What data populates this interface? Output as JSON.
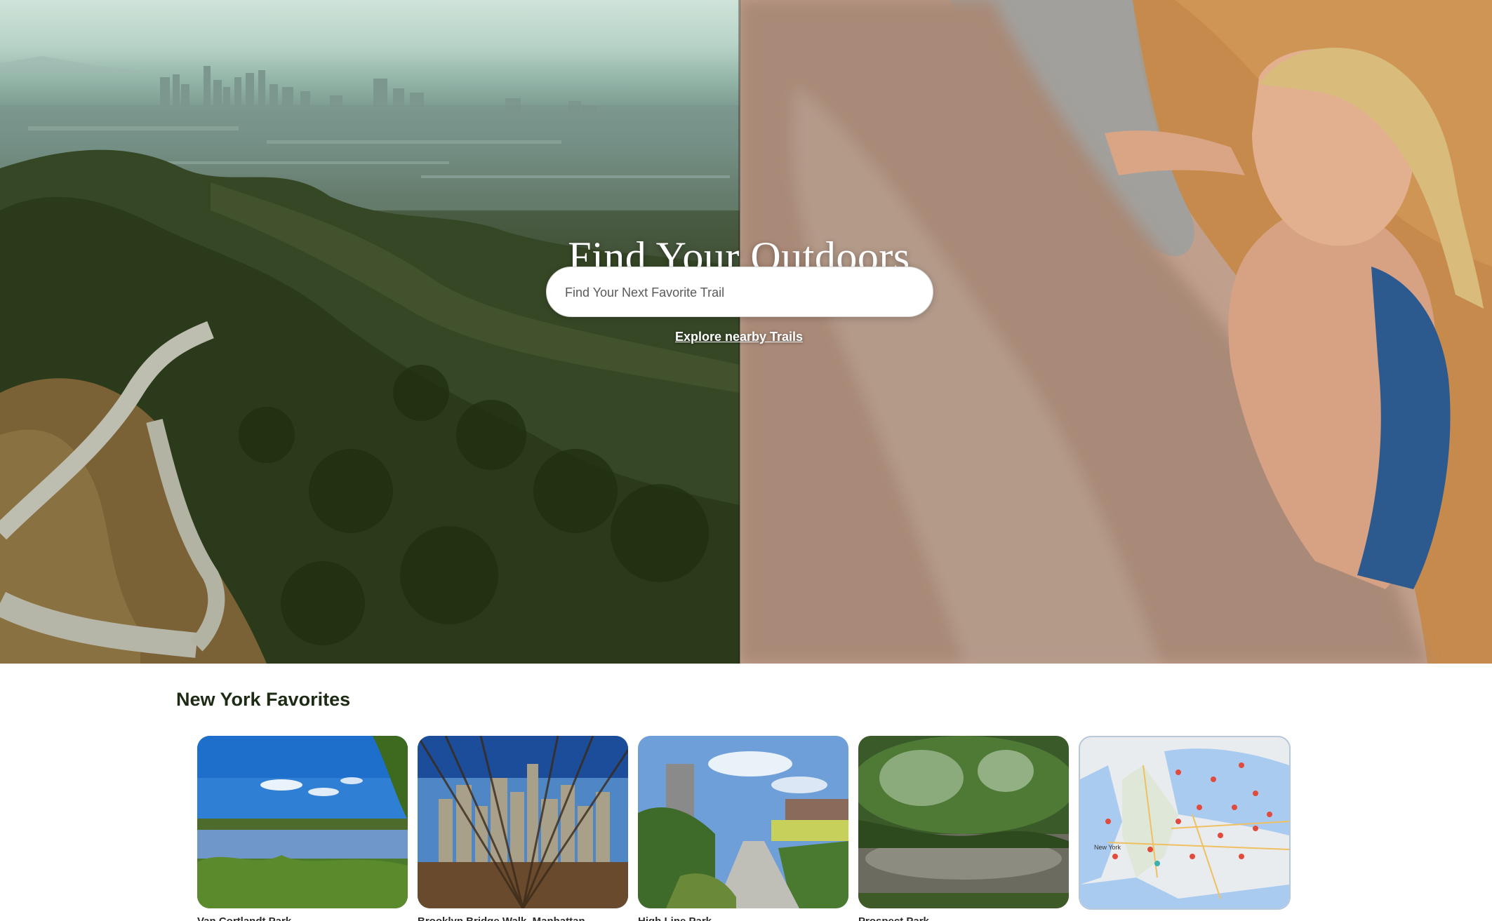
{
  "hero": {
    "title": "Find Your Outdoors",
    "search_placeholder": "Find Your Next Favorite Trail",
    "explore_link": "Explore nearby Trails"
  },
  "favorites": {
    "title": "New York Favorites",
    "cards": [
      {
        "label": "Van Cortlandt Park"
      },
      {
        "label": "Brooklyn Bridge Walk, Manhattan"
      },
      {
        "label": "High Line Park"
      },
      {
        "label": "Prospect Park"
      },
      {
        "label": "",
        "map_label": "New York"
      }
    ]
  },
  "colors": {
    "heading": "#1d2b14",
    "hero_text": "#ffffff"
  }
}
